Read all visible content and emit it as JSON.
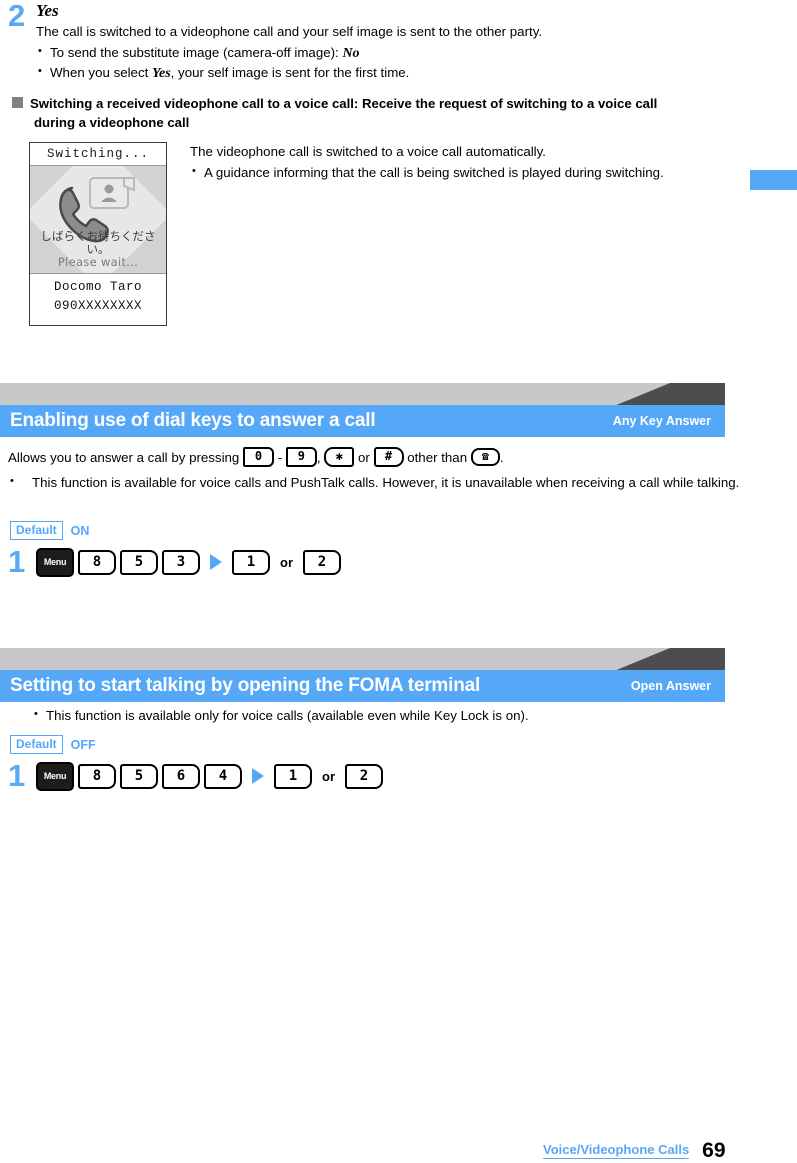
{
  "step2": {
    "number": "2",
    "title": "Yes",
    "description": "The call is switched to a videophone call and your self image is sent to the other party.",
    "bullets": [
      {
        "pre": "To send the substitute image (camera-off image): ",
        "em": "No",
        "post": ""
      },
      {
        "pre": "When you select ",
        "em": "Yes",
        "post": ", your self image is sent for the first time."
      }
    ]
  },
  "subheading": {
    "line1": "Switching a received videophone call to a voice call: Receive the request of switching to a voice call",
    "line2": "during a videophone call"
  },
  "figure": {
    "status_title": "Switching...",
    "wait_jp": "しばらくお待ちください。",
    "wait_en": "Please wait...",
    "caller_name": "Docomo Taro",
    "caller_number": "090XXXXXXXX",
    "icon_name": "videophone-handset-icon"
  },
  "figure_notes": {
    "lead": "The videophone call is switched to a voice call automatically.",
    "bullet": "A guidance informing that the call is being switched is played during switching."
  },
  "section1": {
    "title": "Enabling use of dial keys to answer a call",
    "tag": "Any Key Answer",
    "intro": {
      "p1": "Allows you to answer a call by pressing",
      "key_from": "0",
      "dash": "-",
      "key_to": "9",
      "comma": ",",
      "key_star": "✱",
      "or": "or",
      "key_hash": "#",
      "p2": "other than",
      "key_phone": "☎",
      "period": "."
    },
    "bullet": "This function is available for voice calls and PushTalk calls. However, it is unavailable when receiving a call while talking.",
    "default_label": "Default",
    "default_value": "ON",
    "step": {
      "number": "1",
      "keys": [
        "Menu",
        "8",
        "5",
        "3"
      ],
      "then_keys": [
        "1",
        "2"
      ],
      "or_label": "or"
    }
  },
  "section2": {
    "title": "Setting to start talking by opening the FOMA terminal",
    "tag": "Open Answer",
    "bullet": "This function is available only for voice calls (available even while Key Lock is on).",
    "default_label": "Default",
    "default_value": "OFF",
    "step": {
      "number": "1",
      "keys": [
        "Menu",
        "8",
        "5",
        "6",
        "4"
      ],
      "then_keys": [
        "1",
        "2"
      ],
      "or_label": "or"
    }
  },
  "footer": {
    "chapter": "Voice/Videophone Calls",
    "page": "69"
  },
  "colors": {
    "accent_blue": "#55a8f7",
    "bar_dark": "#4d4d4d",
    "bar_light": "#c8c8c8",
    "square_gray": "#808080"
  }
}
